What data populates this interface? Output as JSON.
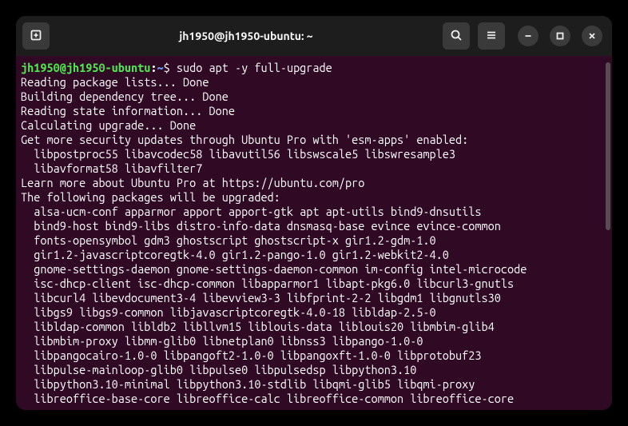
{
  "window": {
    "title": "jh1950@jh1950-ubuntu: ~"
  },
  "prompt": {
    "user_host": "jh1950@jh1950-ubuntu",
    "sep": ":",
    "path": "~",
    "symbol": "$"
  },
  "command": "sudo apt -y full-upgrade",
  "output_lines": [
    "Reading package lists... Done",
    "Building dependency tree... Done",
    "Reading state information... Done",
    "Calculating upgrade... Done",
    "Get more security updates through Ubuntu Pro with 'esm-apps' enabled:",
    "  libpostproc55 libavcodec58 libavutil56 libswscale5 libswresample3",
    "  libavformat58 libavfilter7",
    "Learn more about Ubuntu Pro at https://ubuntu.com/pro",
    "The following packages will be upgraded:",
    "  alsa-ucm-conf apparmor apport apport-gtk apt apt-utils bind9-dnsutils",
    "  bind9-host bind9-libs distro-info-data dnsmasq-base evince evince-common",
    "  fonts-opensymbol gdm3 ghostscript ghostscript-x gir1.2-gdm-1.0",
    "  gir1.2-javascriptcoregtk-4.0 gir1.2-pango-1.0 gir1.2-webkit2-4.0",
    "  gnome-settings-daemon gnome-settings-daemon-common im-config intel-microcode",
    "  isc-dhcp-client isc-dhcp-common libapparmor1 libapt-pkg6.0 libcurl3-gnutls",
    "  libcurl4 libevdocument3-4 libevview3-3 libfprint-2-2 libgdm1 libgnutls30",
    "  libgs9 libgs9-common libjavascriptcoregtk-4.0-18 libldap-2.5-0",
    "  libldap-common libldb2 libllvm15 liblouis-data liblouis20 libmbim-glib4",
    "  libmbim-proxy libmm-glib0 libnetplan0 libnss3 libpango-1.0-0",
    "  libpangocairo-1.0-0 libpangoft2-1.0-0 libpangoxft-1.0-0 libprotobuf23",
    "  libpulse-mainloop-glib0 libpulse0 libpulsedsp libpython3.10",
    "  libpython3.10-minimal libpython3.10-stdlib libqmi-glib5 libqmi-proxy",
    "  libreoffice-base-core libreoffice-calc libreoffice-common libreoffice-core"
  ],
  "icons": {
    "new_tab": "new-tab-icon",
    "search": "search-icon",
    "menu": "hamburger-icon",
    "minimize": "minimize-icon",
    "maximize": "maximize-icon",
    "close": "close-icon"
  }
}
